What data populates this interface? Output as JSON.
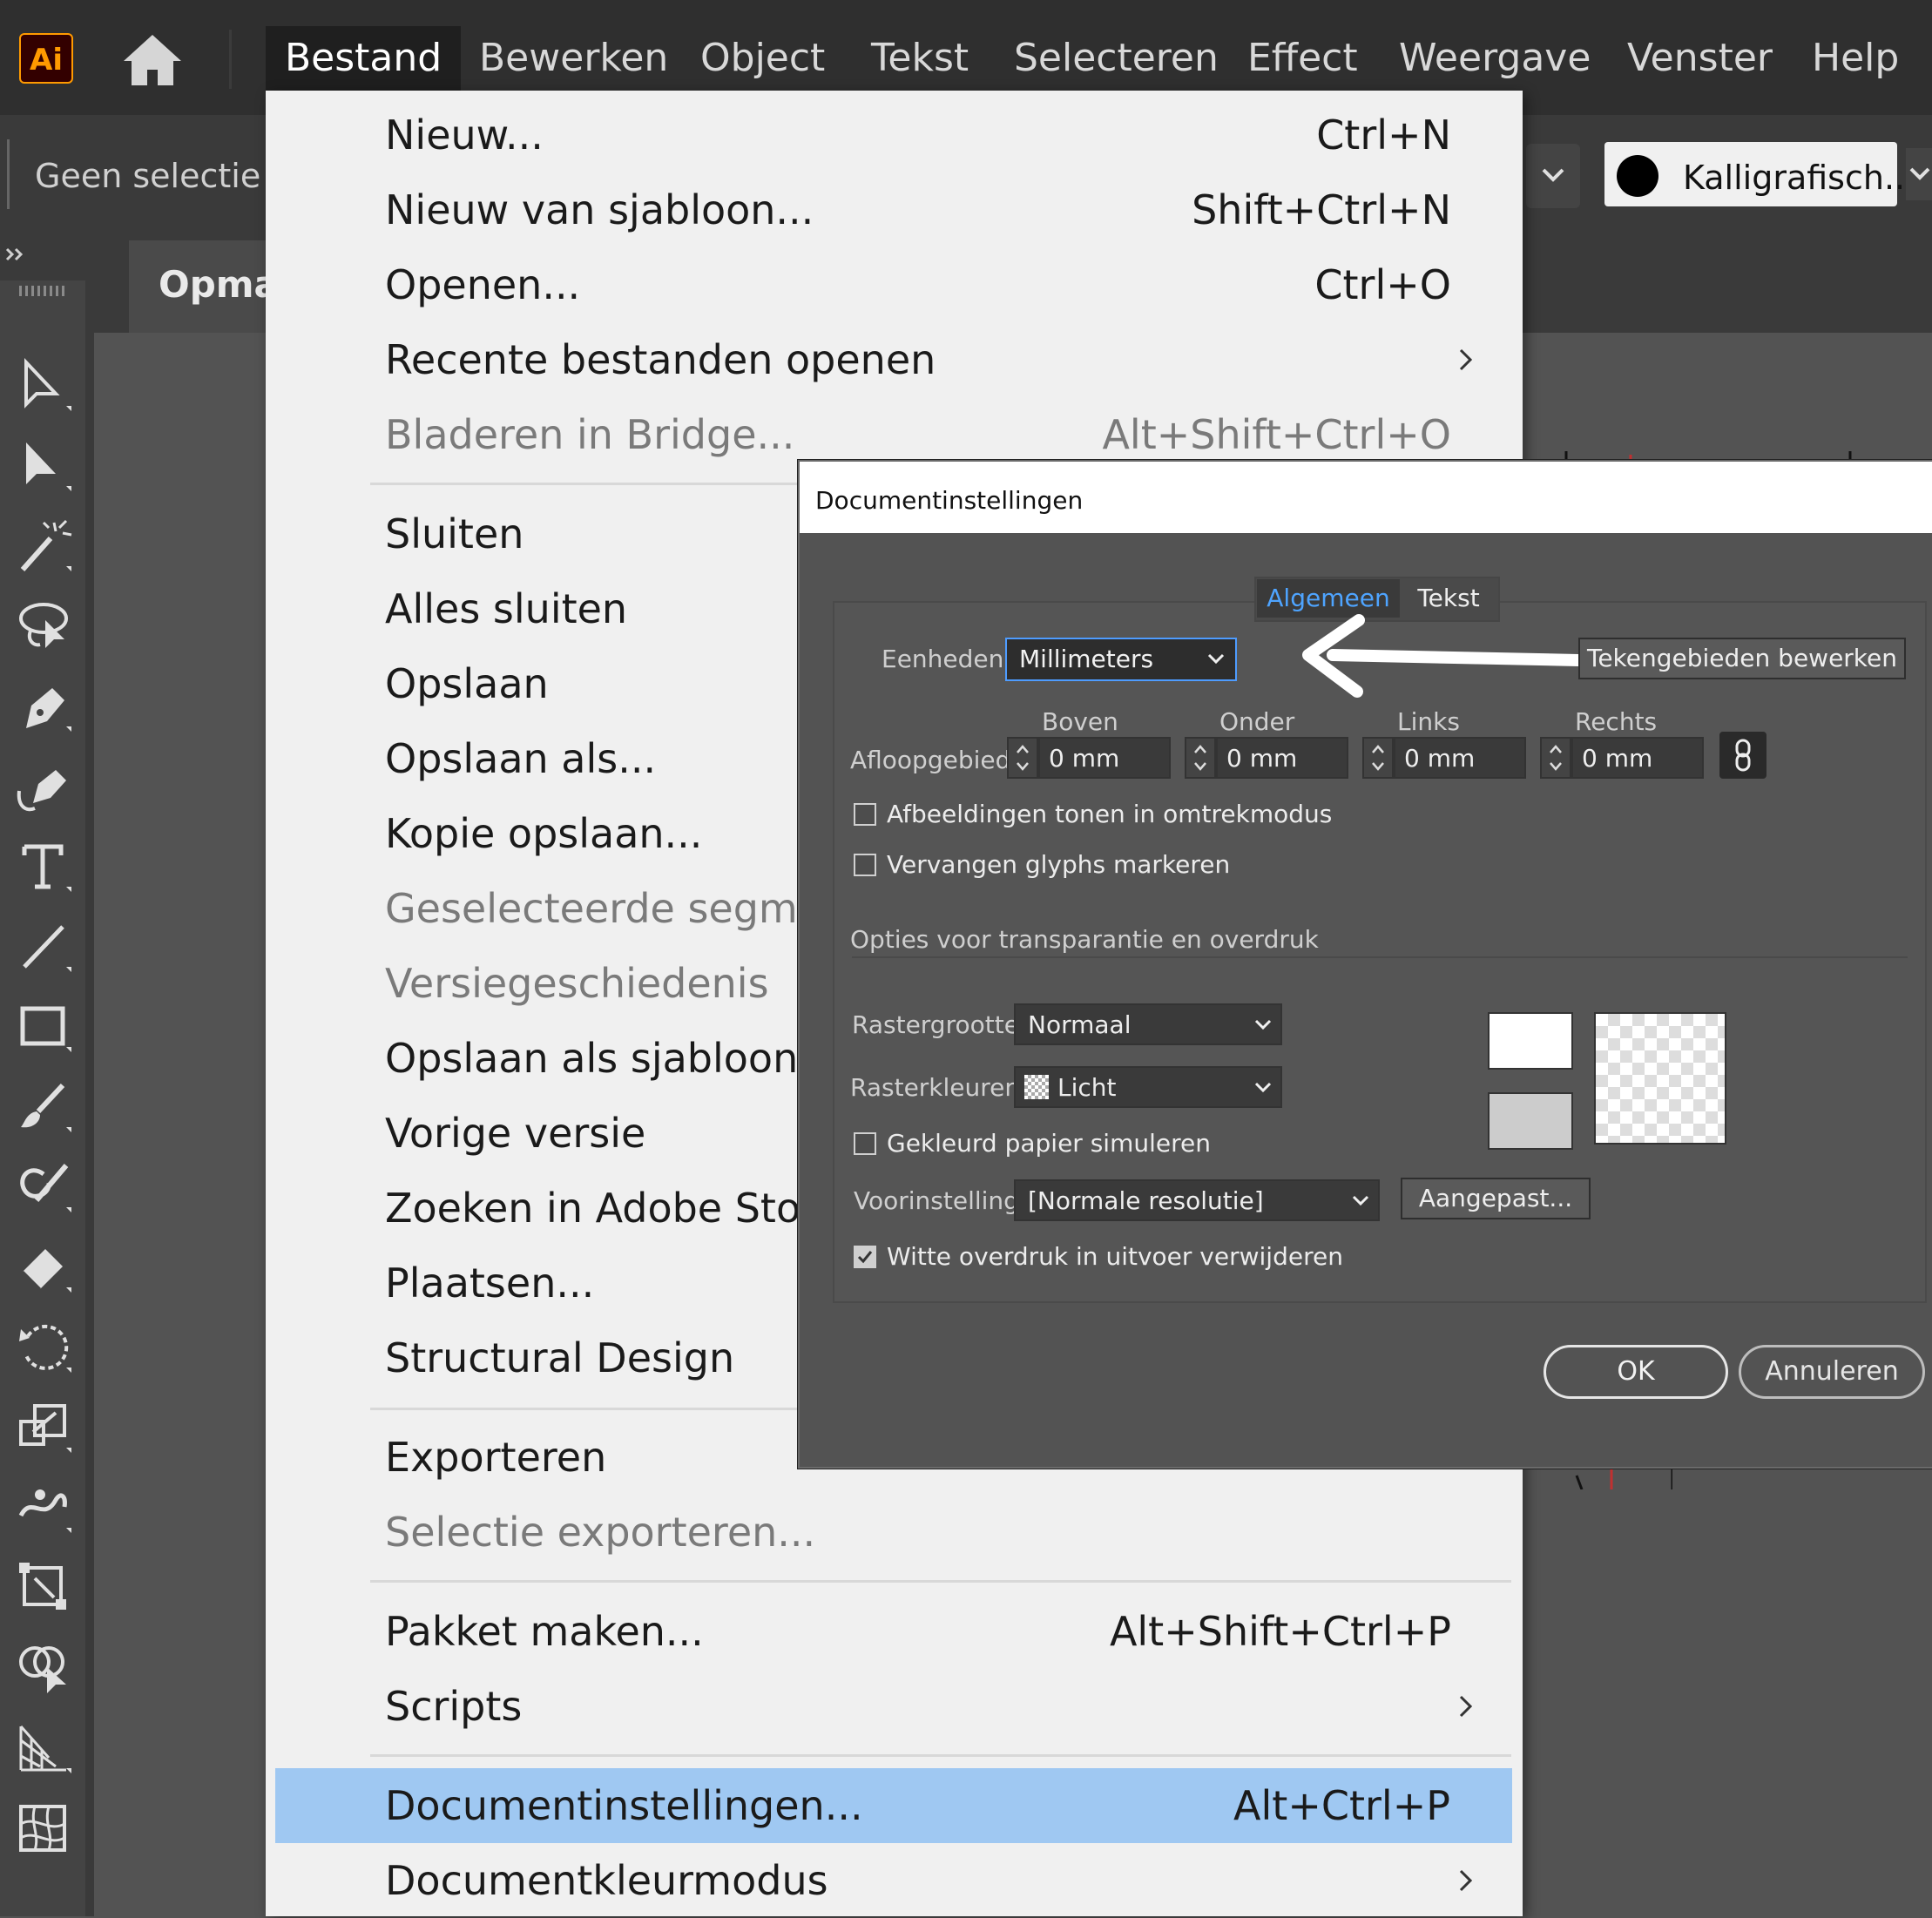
{
  "app": {
    "logo": "Ai",
    "home_icon": "home-icon"
  },
  "menubar": {
    "items": [
      "Bestand",
      "Bewerken",
      "Object",
      "Tekst",
      "Selecteren",
      "Effect",
      "Weergave",
      "Venster",
      "Help"
    ],
    "active_item": "Bestand"
  },
  "control_bar": {
    "selection_status": "Geen selectie",
    "brush_label": "Kalligrafisch..."
  },
  "document_tab": {
    "label": "Opma"
  },
  "file_menu": {
    "items": [
      {
        "label": "Nieuw...",
        "shortcut": "Ctrl+N"
      },
      {
        "label": "Nieuw van sjabloon...",
        "shortcut": "Shift+Ctrl+N"
      },
      {
        "label": "Openen...",
        "shortcut": "Ctrl+O"
      },
      {
        "label": "Recente bestanden openen",
        "submenu": true
      },
      {
        "label": "Bladeren in Bridge...",
        "shortcut": "Alt+Shift+Ctrl+O",
        "disabled": true
      },
      {
        "label": "Sluiten"
      },
      {
        "label": "Alles sluiten"
      },
      {
        "label": "Opslaan"
      },
      {
        "label": "Opslaan als..."
      },
      {
        "label": "Kopie opslaan..."
      },
      {
        "label": "Geselecteerde segmen",
        "disabled": true
      },
      {
        "label": "Versiegeschiedenis",
        "disabled": true
      },
      {
        "label": "Opslaan als sjabloon..."
      },
      {
        "label": "Vorige versie"
      },
      {
        "label": "Zoeken in Adobe Stock"
      },
      {
        "label": "Plaatsen..."
      },
      {
        "label": "Structural Design"
      },
      {
        "label": "Exporteren"
      },
      {
        "label": "Selectie exporteren...",
        "disabled": true
      },
      {
        "label": "Pakket maken...",
        "shortcut": "Alt+Shift+Ctrl+P"
      },
      {
        "label": "Scripts",
        "submenu": true
      },
      {
        "label": "Documentinstellingen...",
        "shortcut": "Alt+Ctrl+P",
        "highlighted": true
      },
      {
        "label": "Documentkleurmodus",
        "submenu": true
      }
    ]
  },
  "dialog": {
    "title": "Documentinstellingen",
    "tabs": [
      "Algemeen",
      "Tekst"
    ],
    "active_tab": "Algemeen",
    "units": {
      "label": "Eenheden:",
      "value": "Millimeters"
    },
    "edit_artboards_button": "Tekengebieden bewerken",
    "bleed": {
      "label": "Afloopgebied:",
      "columns": [
        "Boven",
        "Onder",
        "Links",
        "Rechts"
      ],
      "values": [
        "0 mm",
        "0 mm",
        "0 mm",
        "0 mm"
      ],
      "linked": true
    },
    "checkbox_outline": {
      "label": "Afbeeldingen tonen in omtrekmodus",
      "checked": false
    },
    "checkbox_glyphs": {
      "label": "Vervangen glyphs markeren",
      "checked": false
    },
    "section_title": "Opties voor transparantie en overdruk",
    "grid_size": {
      "label": "Rastergrootte:",
      "value": "Normaal"
    },
    "grid_colors": {
      "label": "Rasterkleuren:",
      "value": "Licht"
    },
    "checkbox_paper": {
      "label": "Gekleurd papier simuleren",
      "checked": false
    },
    "preset": {
      "label": "Voorinstelling:",
      "value": "[Normale resolutie]"
    },
    "custom_button": "Aangepast...",
    "checkbox_overprint": {
      "label": "Witte overdruk in uitvoer verwijderen",
      "checked": true
    },
    "ok_button": "OK",
    "cancel_button": "Annuleren"
  },
  "colors": {
    "menubar_bg": "#2f2f2f",
    "menu_bg": "#f0f0f0",
    "menu_highlight": "#9fc8f2",
    "dialog_bg": "#535353",
    "active_tab_text": "#4ea4ff",
    "ai_logo_fg": "#ff9a00",
    "ai_logo_bg": "#330000"
  }
}
